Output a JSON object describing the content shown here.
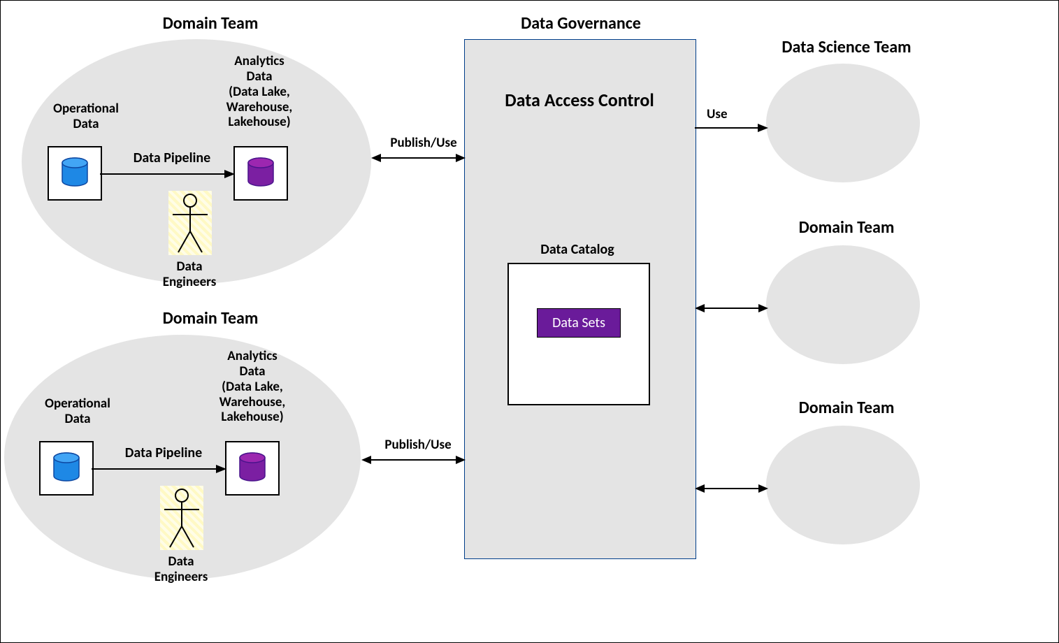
{
  "titles": {
    "domain_team": "Domain Team",
    "data_governance": "Data Governance",
    "data_science_team": "Data Science Team"
  },
  "labels": {
    "operational_data": "Operational\nData",
    "analytics_data": "Analytics\nData\n(Data Lake,\nWarehouse,\nLakehouse)",
    "data_pipeline": "Data Pipeline",
    "data_engineers": "Data\nEngineers",
    "data_access_control": "Data Access Control",
    "data_catalog": "Data Catalog",
    "data_sets": "Data Sets",
    "publish_use": "Publish/Use",
    "use": "Use"
  },
  "colors": {
    "ellipse_fill": "#e4e4e4",
    "gov_border": "#003e8a",
    "db_blue": "#1e88e5",
    "db_purple": "#7b1fa2",
    "datasets_fill": "#6a1b9a"
  }
}
